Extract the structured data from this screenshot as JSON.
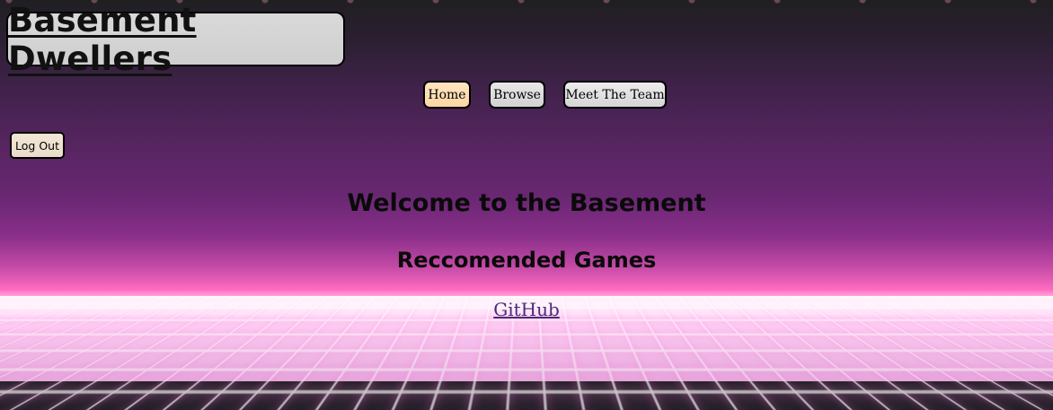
{
  "site": {
    "title": "Basement Dwellers"
  },
  "nav": {
    "items": [
      {
        "label": "Home"
      },
      {
        "label": "Browse"
      },
      {
        "label": "Meet The Team"
      }
    ]
  },
  "auth": {
    "logout_label": "Log Out"
  },
  "main": {
    "welcome": "Welcome to the Basement",
    "recommended_heading": "Reccomended Games",
    "github_link": "GitHub"
  },
  "colors": {
    "home_button": "#ffe4bf",
    "link": "#4a2a78",
    "background_top": "#1f1f22",
    "background_purple": "#6a2773",
    "horizon_pink": "#ff6cc0"
  }
}
